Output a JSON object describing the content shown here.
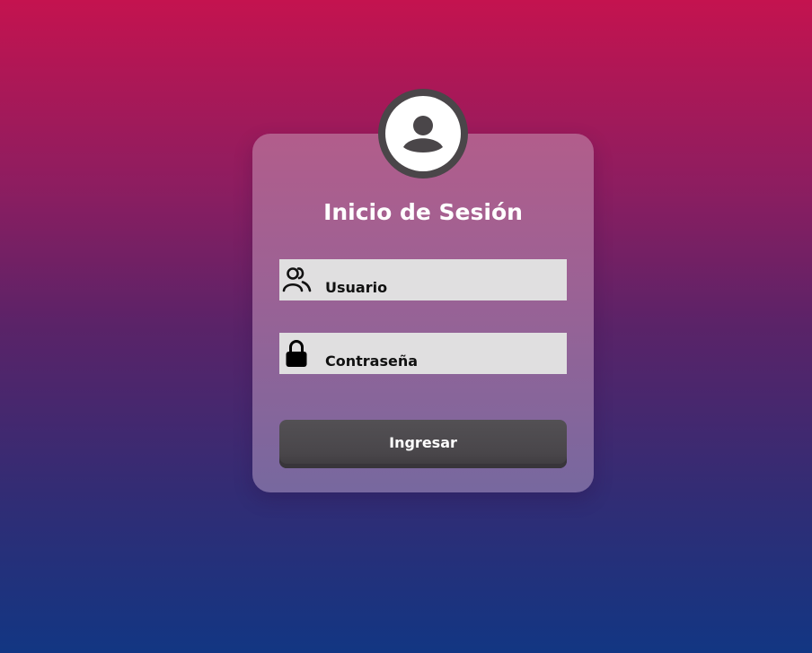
{
  "login": {
    "title": "Inicio de Sesión",
    "username_placeholder": "Usuario",
    "password_placeholder": "Contraseña",
    "submit_label": "Ingresar"
  },
  "icons": {
    "avatar": "user-avatar-icon",
    "username": "users-icon",
    "password": "lock-icon"
  },
  "colors": {
    "background_top": "#c4134f",
    "background_bottom": "#123683",
    "button": "#4d4a4e",
    "field": "#e0dfe0"
  }
}
